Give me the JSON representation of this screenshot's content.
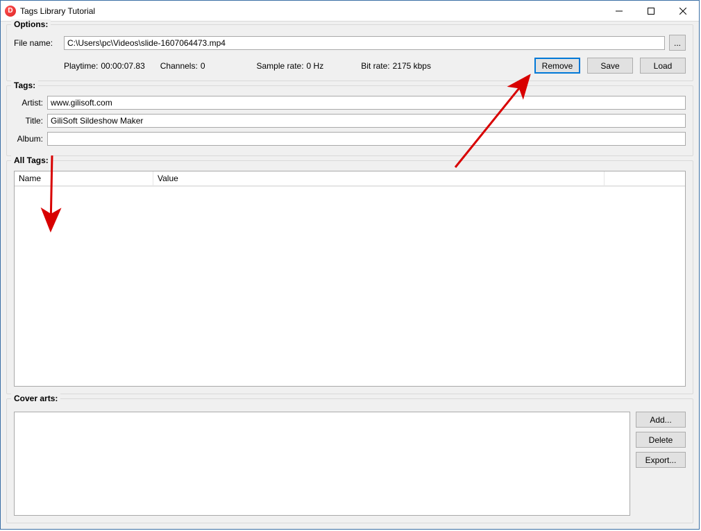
{
  "window": {
    "title": "Tags Library Tutorial"
  },
  "options": {
    "legend": "Options:",
    "file_label": "File name:",
    "file_value": "C:\\Users\\pc\\Videos\\slide-1607064473.mp4",
    "browse_label": "...",
    "playtime_label": "Playtime:",
    "playtime_value": "00:00:07.83",
    "channels_label": "Channels:",
    "channels_value": "0",
    "samplerate_label": "Sample rate:",
    "samplerate_value": "0 Hz",
    "bitrate_label": "Bit rate:",
    "bitrate_value": "2175 kbps",
    "remove_label": "Remove",
    "save_label": "Save",
    "load_label": "Load"
  },
  "tags": {
    "legend": "Tags:",
    "artist_label": "Artist:",
    "artist_value": "www.gilisoft.com",
    "title_label": "Title:",
    "title_value": "GiliSoft Sildeshow Maker",
    "album_label": "Album:",
    "album_value": ""
  },
  "all_tags": {
    "legend": "All Tags:",
    "col_name": "Name",
    "col_value": "Value",
    "rows": []
  },
  "cover_arts": {
    "legend": "Cover arts:",
    "add_label": "Add...",
    "delete_label": "Delete",
    "export_label": "Export..."
  }
}
